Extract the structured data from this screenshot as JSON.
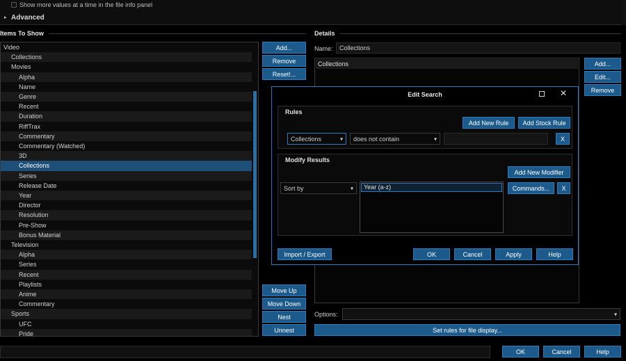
{
  "top_panel": {
    "checkbox_label": "Show more values at a time in the file info panel",
    "advanced_label": "Advanced"
  },
  "items_to_show": {
    "header": "Items To Show",
    "tree": [
      {
        "label": "Video",
        "level": 0
      },
      {
        "label": "Collections",
        "level": 1
      },
      {
        "label": "Movies",
        "level": 1
      },
      {
        "label": "Alpha",
        "level": 2
      },
      {
        "label": "Name",
        "level": 2
      },
      {
        "label": "Genre",
        "level": 2
      },
      {
        "label": "Recent",
        "level": 2
      },
      {
        "label": "Duration",
        "level": 2
      },
      {
        "label": "RiffTrax",
        "level": 2
      },
      {
        "label": "Commentary",
        "level": 2
      },
      {
        "label": "Commentary (Watched)",
        "level": 2
      },
      {
        "label": "3D",
        "level": 2
      },
      {
        "label": "Collections",
        "level": 2,
        "selected": true
      },
      {
        "label": "Series",
        "level": 2
      },
      {
        "label": "Release Date",
        "level": 2
      },
      {
        "label": "Year",
        "level": 2
      },
      {
        "label": "Director",
        "level": 2
      },
      {
        "label": "Resolution",
        "level": 2
      },
      {
        "label": "Pre-Show",
        "level": 2
      },
      {
        "label": "Bonus Material",
        "level": 2
      },
      {
        "label": "Television",
        "level": 1
      },
      {
        "label": "Alpha",
        "level": 2
      },
      {
        "label": "Series",
        "level": 2
      },
      {
        "label": "Recent",
        "level": 2
      },
      {
        "label": "Playlists",
        "level": 2
      },
      {
        "label": "Anime",
        "level": 2
      },
      {
        "label": "Commentary",
        "level": 2
      },
      {
        "label": "Sports",
        "level": 1
      },
      {
        "label": "UFC",
        "level": 2
      },
      {
        "label": "Pride",
        "level": 2
      }
    ],
    "buttons": {
      "add": "Add...",
      "remove": "Remove",
      "reset": "Reset!...",
      "move_up": "Move Up",
      "move_down": "Move Down",
      "nest": "Nest",
      "unnest": "Unnest"
    }
  },
  "details": {
    "header": "Details",
    "name_label": "Name:",
    "name_value": "Collections",
    "list_item": "Collections",
    "buttons": {
      "add": "Add...",
      "edit": "Edit...",
      "remove": "Remove"
    },
    "options_label": "Options:",
    "options_value": "",
    "set_rules_button": "Set rules for file display..."
  },
  "edit_search": {
    "title": "Edit Search",
    "rules_header": "Rules",
    "add_new_rule": "Add New Rule",
    "add_stock_rule": "Add Stock Rule",
    "rule_field": "Collections",
    "rule_operator": "does not contain",
    "rule_value": "",
    "remove_rule": "X",
    "modify_header": "Modify Results",
    "add_new_modifier": "Add New Modifier",
    "modifier_type": "Sort by",
    "modifier_list": [
      "Year (a-z)"
    ],
    "commands_button": "Commands...",
    "remove_modifier": "X",
    "import_export": "Import / Export",
    "ok": "OK",
    "cancel": "Cancel",
    "apply": "Apply",
    "help": "Help"
  },
  "footer": {
    "ok": "OK",
    "cancel": "Cancel",
    "help": "Help"
  },
  "colors": {
    "accent": "#1c5a8c",
    "selection": "#1d4f79",
    "background": "#000000"
  }
}
